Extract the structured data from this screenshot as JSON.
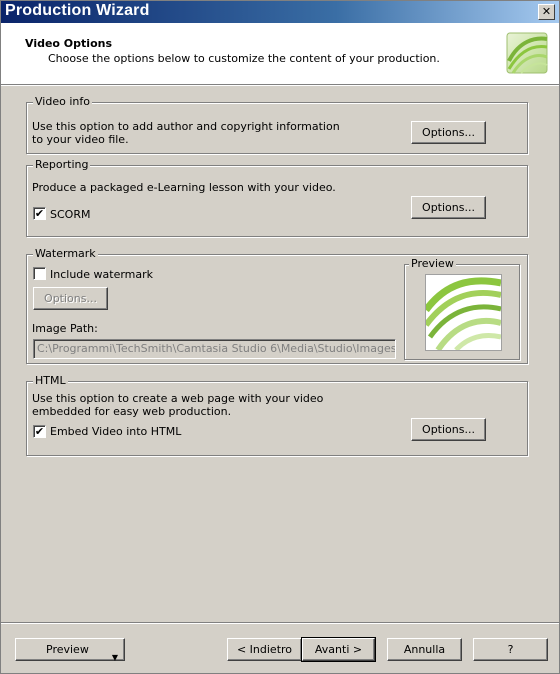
{
  "window": {
    "title": "Production Wizard",
    "close_label": "✕"
  },
  "header": {
    "title": "Video Options",
    "subtitle": "Choose the options below to customize the content of your production."
  },
  "video_info": {
    "legend": "Video info",
    "description": "Use this option to add author and copyright information to your video file.",
    "options_button": "Options..."
  },
  "reporting": {
    "legend": "Reporting",
    "description": "Produce a packaged  e-Learning lesson with your video.",
    "scorm_label": "SCORM",
    "scorm_checked": true,
    "options_button": "Options..."
  },
  "watermark": {
    "legend": "Watermark",
    "include_label": "Include watermark",
    "include_checked": false,
    "options_button": "Options...",
    "image_path_label": "Image Path:",
    "image_path_value": "C:\\Programmi\\TechSmith\\Camtasia Studio 6\\Media\\Studio\\Images\\waterm",
    "preview_legend": "Preview"
  },
  "html": {
    "legend": "HTML",
    "description": "Use this option to create a web page with your video embedded for easy web production.",
    "embed_label": "Embed Video into HTML",
    "embed_checked": true,
    "options_button": "Options..."
  },
  "footer": {
    "preview_button": "Preview",
    "back_button": "< Indietro",
    "next_button": "Avanti >",
    "cancel_button": "Annulla",
    "help_button": "?"
  },
  "icons": {
    "logo": "camtasia-swirl-logo",
    "check": "✔",
    "dropdown": "▼"
  },
  "colors": {
    "dialog_bg": "#d4d0c8",
    "title_gradient_start": "#0a246a",
    "title_gradient_end": "#a6caf0",
    "logo_green": "#8cc63f"
  }
}
